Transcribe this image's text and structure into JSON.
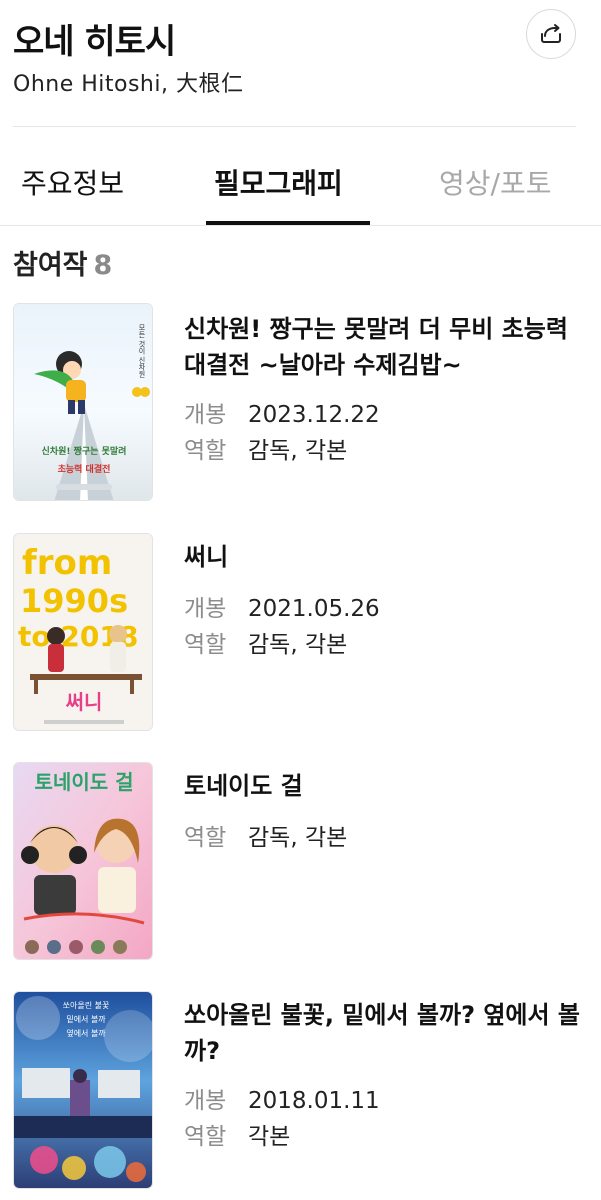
{
  "person": {
    "name": "오네 히토시",
    "subname": "Ohne Hitoshi, 大根仁"
  },
  "tabs": [
    {
      "label": "주요정보"
    },
    {
      "label": "필모그래피"
    },
    {
      "label": "영상/포토"
    }
  ],
  "filmography": {
    "title": "참여작",
    "count": "8",
    "release_label": "개봉",
    "role_label": "역할",
    "items": [
      {
        "title": "신차원! 짱구는 못말려 더 무비 초능력 대결전 ~날아라 수제김밥~",
        "release": "2023.12.22",
        "role": "감독, 각본",
        "poster_text": [
          "모든 것이 신차원",
          "신차원! 짱구는 못말려",
          "초능력 대결전"
        ]
      },
      {
        "title": "써니",
        "release": "2021.05.26",
        "role": "감독, 각본",
        "poster_text": [
          "from",
          "1990s",
          "to 2018",
          "써니"
        ]
      },
      {
        "title": "토네이도 걸",
        "role": "감독, 각본",
        "poster_text": [
          "토네이도 걸"
        ]
      },
      {
        "title": "쏘아올린 불꽃, 밑에서 볼까? 옆에서 볼까?",
        "release": "2018.01.11",
        "role": "각본",
        "poster_text": [
          "쏘아올린 불꽃",
          "밑에서 볼까",
          "옆에서 볼까"
        ]
      }
    ]
  },
  "colors": {
    "text": "#111111",
    "muted": "#8c8c8c",
    "inactive_tab": "#a8a8a8",
    "divider": "#e6e6e6"
  },
  "icons": {
    "share": "share-icon"
  }
}
